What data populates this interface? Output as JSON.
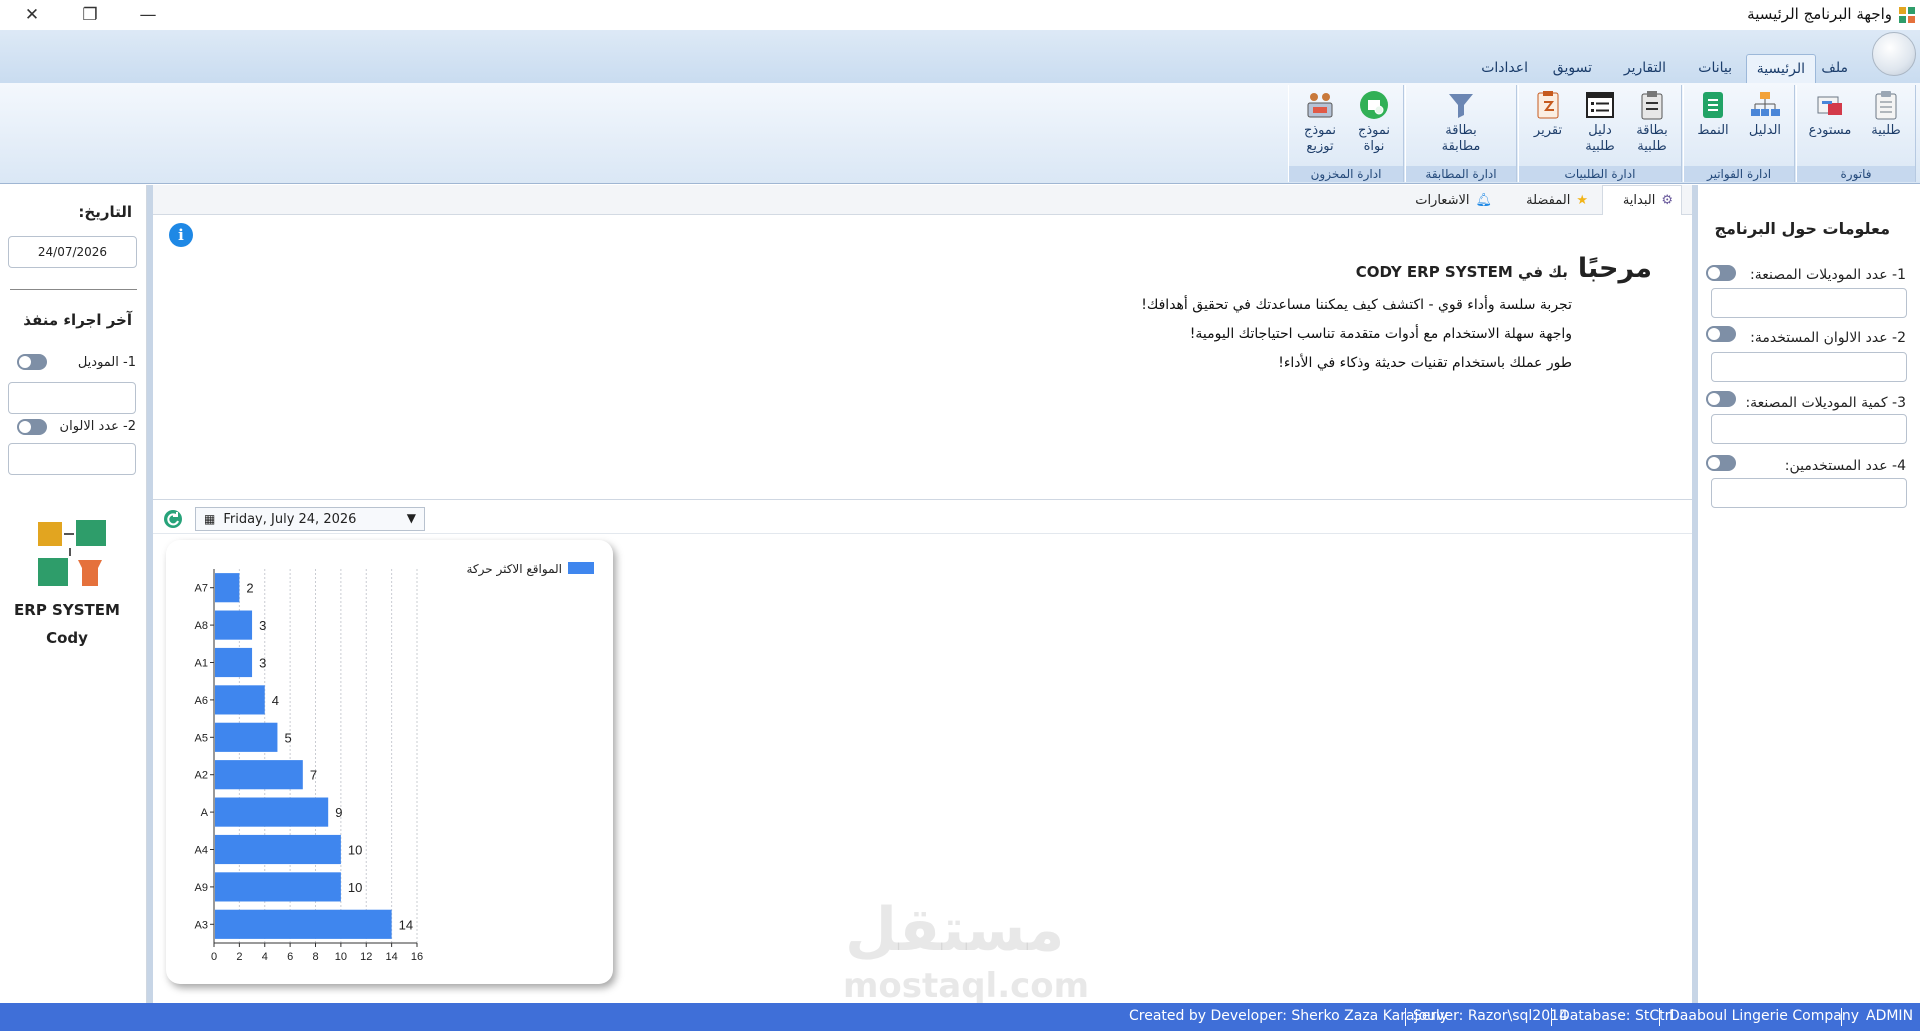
{
  "window": {
    "title": "واجهة البرنامج الرئيسية",
    "close_glyph": "✕",
    "restore_glyph": "❐",
    "minimize_glyph": "—"
  },
  "ribbon_tabs": [
    {
      "label": "ملف",
      "active": false
    },
    {
      "label": "الرئيسية",
      "active": true
    },
    {
      "label": "بيانات",
      "active": false
    },
    {
      "label": "التقارير",
      "active": false
    },
    {
      "label": "تسويق",
      "active": false
    },
    {
      "label": "اعدادات",
      "active": false
    }
  ],
  "ribbon_groups": {
    "invoice": {
      "title": "فاتورة",
      "btn1": "طلبية",
      "btn2": "مستودع"
    },
    "invoices_mgmt": {
      "title": "ادارة الفواتير",
      "btn1": "الدليل",
      "btn2": "النمط"
    },
    "orders_mgmt": {
      "title": "ادارة الطلبيات",
      "btn1_l1": "بطاقة",
      "btn1_l2": "طلبية",
      "btn2_l1": "دليل",
      "btn2_l2": "طلبية",
      "btn3": "تقرير"
    },
    "matching_mgmt": {
      "title": "ادارة المطابقة",
      "btn1_l1": "بطاقة",
      "btn1_l2": "مطابقة"
    },
    "stock_mgmt": {
      "title": "ادارة المخزون",
      "btn1_l1": "نموذج",
      "btn1_l2": "نواة",
      "btn2_l1": "نموذج",
      "btn2_l2": "توزيع"
    }
  },
  "left_panel": {
    "date_label": "التاريخ:",
    "date_value": "24/07/2026",
    "last_action_label": "آخر اجراء منفذ",
    "option1": "1- الموديل",
    "option2": "2- عدد الالوان",
    "brand_line1": "ERP SYSTEM",
    "brand_line2": "Cody"
  },
  "right_panel": {
    "title": "معلومات حول البرنامج",
    "stat1": "1- عدد الموديلات المصنعة:",
    "stat2": "2- عدد الالوان المستخدمة:",
    "stat3": "3- كمية الموديلات المصنعة:",
    "stat4": "4- عدد المستخدمين:"
  },
  "doc_tabs": {
    "home": "البداية",
    "favorites": "المفضلة",
    "notifications": "الاشعارات"
  },
  "welcome": {
    "title_big": "مرحبًا",
    "title_small": "بك في CODY ERP SYSTEM",
    "line1": "تجربة سلسة وأداء قوي - اكتشف كيف يمكننا مساعدتك في تحقيق أهدافك!",
    "line2": "واجهة سهلة الاستخدام مع أدوات متقدمة تناسب احتياجاتك اليومية!",
    "line3": "طور عملك باستخدام تقنيات حديثة وذكاء في الأداء!"
  },
  "date_picker": {
    "value": "Friday, July 24, 2026"
  },
  "chart_data": {
    "type": "bar",
    "orientation": "horizontal",
    "categories": [
      "A7",
      "A8",
      "A1",
      "A6",
      "A5",
      "A2",
      "A",
      "A4",
      "A9",
      "A3"
    ],
    "values": [
      2,
      3,
      3,
      4,
      5,
      7,
      9,
      10,
      10,
      14
    ],
    "series": [
      {
        "name": "المواقع الاكثر حركة",
        "values": [
          2,
          3,
          3,
          4,
          5,
          7,
          9,
          10,
          10,
          14
        ]
      }
    ],
    "xlim": [
      0,
      16
    ],
    "x_ticks": [
      0,
      2,
      4,
      6,
      8,
      10,
      12,
      14,
      16
    ],
    "grid": true,
    "legend": "top-right",
    "bar_color": "#3f86ee",
    "data_labels": true
  },
  "watermark": {
    "line1": "مستقل",
    "line2": "mostaql.com"
  },
  "status_bar": {
    "developer": "Created by Developer: Sherko Zaza Karajouly",
    "server": "Server: Razor\\sql2014",
    "database": "Database: StCtrl",
    "company": "Daaboul Lingerie Company",
    "user": "ADMIN"
  },
  "colors": {
    "accent": "#3f6fd8",
    "ribbon": "#dae7f5",
    "bar": "#3f86ee"
  }
}
